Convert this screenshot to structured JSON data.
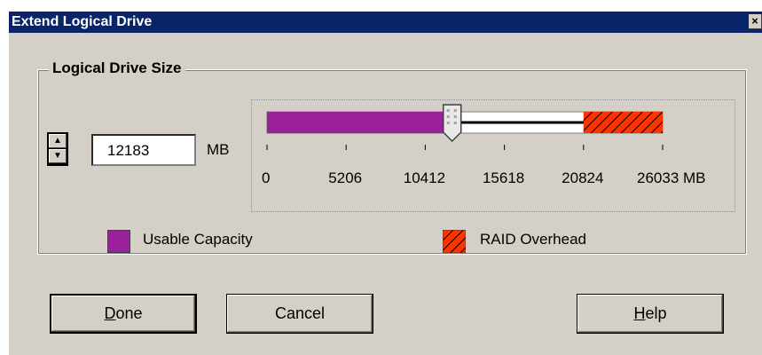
{
  "window": {
    "title": "Extend Logical Drive",
    "close_glyph": "×"
  },
  "size_group": {
    "label": "Logical Drive Size",
    "size_value": "12183",
    "size_unit": "MB",
    "spin_up_glyph": "▲",
    "spin_down_glyph": "▼"
  },
  "slider": {
    "tick_labels": [
      "0",
      "5206",
      "10412",
      "15618",
      "20824",
      "26033 MB"
    ],
    "scale_max_mb": 26033,
    "usable_capacity_mb": 12183,
    "raid_overhead_start_mb": 20824,
    "thumb_value_mb": 12183,
    "colors": {
      "usable": "#9a1f9a",
      "overhead": "#ff3300",
      "hatch": "#000000"
    }
  },
  "legend": {
    "usable_label": "Usable Capacity",
    "overhead_label": "RAID Overhead"
  },
  "buttons": {
    "done": {
      "mnemonic": "D",
      "rest": "one"
    },
    "cancel": "Cancel",
    "help": {
      "mnemonic": "H",
      "rest": "elp"
    }
  }
}
